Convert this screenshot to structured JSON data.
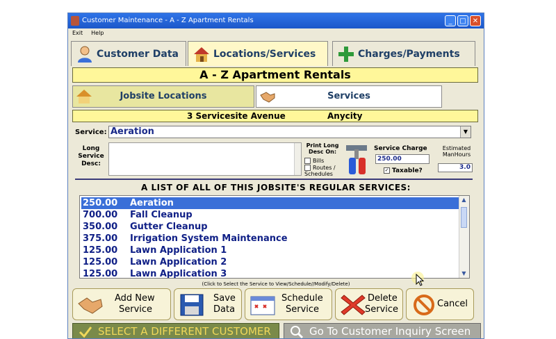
{
  "window": {
    "title": "Customer Maintenance  -  A - Z Apartment Rentals"
  },
  "menu": {
    "items": [
      "Exit",
      "Help"
    ]
  },
  "tabs": [
    {
      "label": "Customer Data",
      "icon": "person-icon"
    },
    {
      "label": "Locations/Services",
      "icon": "house-icon"
    },
    {
      "label": "Charges/Payments",
      "icon": "plus-icon"
    }
  ],
  "customer_name": "A - Z Apartment Rentals",
  "subtabs": [
    {
      "label": "Jobsite Locations",
      "icon": "house-icon"
    },
    {
      "label": "Services",
      "icon": "handshake-icon"
    }
  ],
  "address": {
    "street": "3 Servicesite Avenue",
    "city": "Anycity"
  },
  "form": {
    "service_label": "Service:",
    "service_value": "Aeration",
    "long_desc_label": "Long Service Desc:",
    "print_label": "Print Long Desc On:",
    "print_options": [
      "Bills",
      "Routes / Schedules"
    ],
    "service_charge_label": "Service Charge",
    "service_charge_value": "250.00",
    "taxable_label": "Taxable?",
    "taxable_checked": true,
    "manhours_label": "Estimated ManHours",
    "manhours_value": "3.0"
  },
  "list": {
    "title": "A LIST OF ALL OF THIS JOBSITE'S REGULAR SERVICES:",
    "rows": [
      {
        "amount": "250.00",
        "name": "Aeration",
        "selected": true
      },
      {
        "amount": "700.00",
        "name": "Fall Cleanup"
      },
      {
        "amount": "350.00",
        "name": "Gutter Cleanup"
      },
      {
        "amount": "375.00",
        "name": "Irrigation System Maintenance"
      },
      {
        "amount": "125.00",
        "name": "Lawn Application 1"
      },
      {
        "amount": "125.00",
        "name": "Lawn Application 2"
      },
      {
        "amount": "125.00",
        "name": "Lawn Application 3"
      }
    ],
    "hint": "(Click to Select the Service to View/Schedule//Modify/Delete)"
  },
  "buttons": [
    {
      "label1": "Add New",
      "label2": "Service",
      "icon": "handshake-icon"
    },
    {
      "label1": "Save",
      "label2": "Data",
      "icon": "floppy-disk-icon"
    },
    {
      "label1": "Schedule",
      "label2": "Service",
      "icon": "calendar-icon"
    },
    {
      "label1": "Delete",
      "label2": "Service",
      "icon": "x-icon"
    },
    {
      "label1": "Cancel",
      "label2": "",
      "icon": "cancel-icon"
    }
  ],
  "bottom": {
    "select_customer": "SELECT A DIFFERENT CUSTOMER",
    "inquiry": "Go To Customer Inquiry Screen"
  },
  "colors": {
    "banner": "#fff79a",
    "selected_row": "#3a6fd8",
    "list_text": "#0f1f86",
    "title_bar": "#2f74e8"
  }
}
